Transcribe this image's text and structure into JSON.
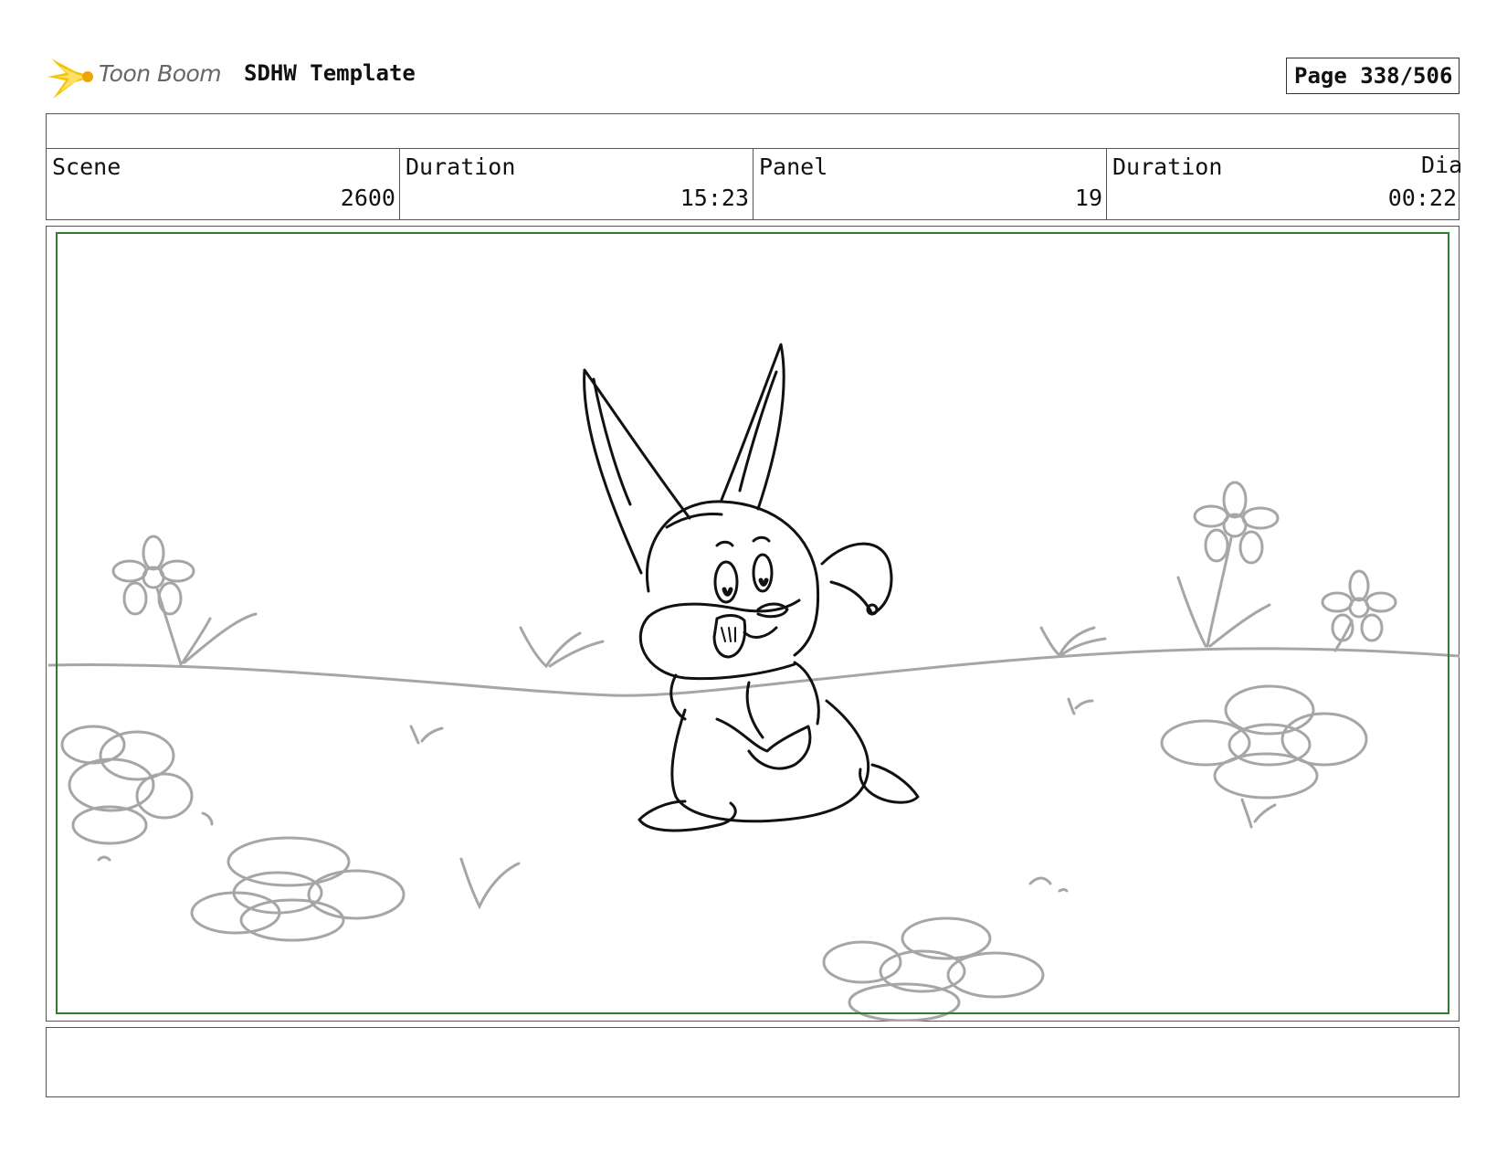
{
  "header": {
    "logo_text": "Toon Boom",
    "title": "SDHW Template",
    "page_label": "Page 338/506"
  },
  "info": {
    "scene_label": "Scene",
    "scene_value": "2600",
    "scene_duration_label": "Duration",
    "scene_duration_value": "15:23",
    "panel_label": "Panel",
    "panel_value": "19",
    "panel_duration_label": "Duration",
    "panel_duration_value": "00:22",
    "dialogue_label": "Dia"
  },
  "colors": {
    "safe_area": "#2e7d32",
    "sketch_dark": "#111111",
    "sketch_light": "#a6a6a6",
    "logo_star": "#f5c400"
  }
}
